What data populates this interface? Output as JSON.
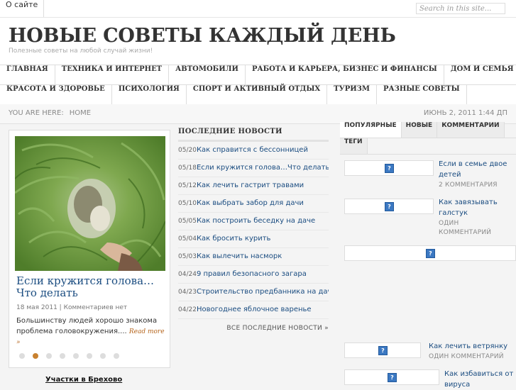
{
  "topbar": {
    "about_label": "О сайте",
    "search_placeholder": "Search in this site..."
  },
  "header": {
    "title": "НОВЫЕ СОВЕТЫ КАЖДЫЙ ДЕНЬ",
    "description": "Полезные советы на любой случай жизни!"
  },
  "nav": {
    "row1": [
      "ГЛАВНАЯ",
      "ТЕХНИКА И ИНТЕРНЕТ",
      "АВТОМОБИЛИ",
      "РАБОТА И КАРЬЕРА, БИЗНЕС И ФИНАНСЫ",
      "ДОМ И СЕМЬЯ"
    ],
    "row2": [
      "КРАСОТА И ЗДОРОВЬЕ",
      "ПСИХОЛОГИЯ",
      "СПОРТ И АКТИВНЫЙ ОТДЫХ",
      "ТУРИЗМ",
      "РАЗНЫЕ СОВЕТЫ"
    ]
  },
  "breadcrumb": {
    "prefix": "YOU ARE HERE:",
    "home": "HOME",
    "datetime": "ИЮНЬ 2, 2011 1:44 ДП"
  },
  "slider": {
    "title": "Если кружится голова…Что делать",
    "date": "18 мая 2011",
    "separator": "|",
    "comments": "Комментариев нет",
    "excerpt": "Большинству людей хорошо знакома проблема головокружения....",
    "read_more": "Read more »",
    "dot_count": 8,
    "active_dot": 1
  },
  "bottom_link": "Участки в Брехово",
  "news": {
    "heading": "ПОСЛЕДНИЕ НОВОСТИ",
    "items": [
      {
        "date": "05/20",
        "title": "Как справится с бессонницей"
      },
      {
        "date": "05/18",
        "title": "Если кружится голова…Что делать"
      },
      {
        "date": "05/12",
        "title": "Как лечить гастрит травами"
      },
      {
        "date": "05/10",
        "title": "Как выбрать забор для дачи"
      },
      {
        "date": "05/05",
        "title": "Как построить беседку на даче"
      },
      {
        "date": "05/04",
        "title": "Как бросить курить"
      },
      {
        "date": "05/03",
        "title": "Как вылечить насморк"
      },
      {
        "date": "04/24",
        "title": "9 правил безопасного загара"
      },
      {
        "date": "04/23",
        "title": "Строительство предбанника на даче"
      },
      {
        "date": "04/22",
        "title": "Новогоднее яблочное варенье"
      }
    ],
    "all_label": "ВСЕ ПОСЛЕДНИЕ НОВОСТИ »"
  },
  "tabs": {
    "row1": [
      "ПОПУЛЯРНЫЕ",
      "НОВЫЕ",
      "КОММЕНТАРИИ"
    ],
    "row2": [
      "ТЕГИ"
    ]
  },
  "popular": {
    "placeholder_glyph": "?",
    "items": [
      {
        "title": "Если в семье двое детей",
        "comments": "2 КОММЕНТАРИЯ"
      },
      {
        "title": "Как завязывать галстук",
        "comments": "ОДИН КОММЕНТАРИЙ"
      },
      {
        "title": "",
        "comments": ""
      },
      {
        "title": "Как лечить ветрянку",
        "comments": "ОДИН КОММЕНТАРИЙ"
      },
      {
        "title": "Как избавиться от вируса",
        "comments": ""
      }
    ]
  },
  "colors": {
    "link": "#1a4c80",
    "accent_dot": "#c8812f"
  }
}
